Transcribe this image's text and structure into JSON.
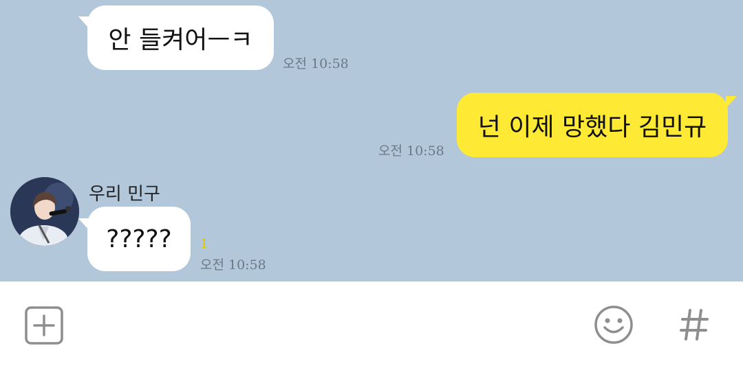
{
  "messages": [
    {
      "direction": "incoming",
      "text": "안 들켜어ㅡㅋ",
      "time": "오전 10:58"
    },
    {
      "direction": "outgoing",
      "text": "넌 이제 망했다 김민규",
      "time": "오전 10:58"
    },
    {
      "direction": "incoming",
      "sender": "우리 민구",
      "text": "?????",
      "unread": "1",
      "time": "오전 10:58"
    }
  ],
  "toolbar": {
    "plus_icon": "plus-square-icon",
    "emoji_icon": "smiley-icon",
    "hashtag_icon": "hashtag-icon"
  },
  "colors": {
    "chat_background": "#b2c7da",
    "outgoing_bubble": "#fee934",
    "incoming_bubble": "#ffffff",
    "unread_count": "#e1c600",
    "icon_gray": "#8e8e8e"
  }
}
